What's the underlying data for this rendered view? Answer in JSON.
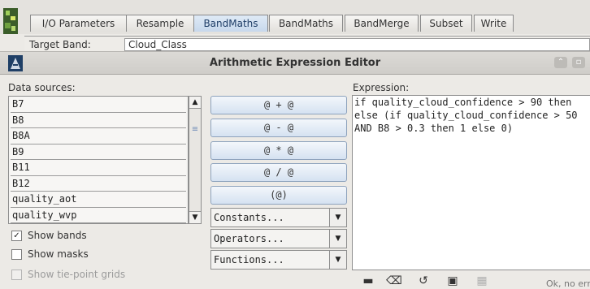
{
  "tabs": [
    {
      "label": "I/O Parameters",
      "active": false
    },
    {
      "label": "Resample",
      "active": false
    },
    {
      "label": "BandMaths",
      "active": true
    },
    {
      "label": "BandMaths",
      "active": false
    },
    {
      "label": "BandMerge",
      "active": false
    },
    {
      "label": "Subset",
      "active": false
    },
    {
      "label": "Write",
      "active": false
    }
  ],
  "target": {
    "label": "Target Band:",
    "value": "Cloud_Class"
  },
  "dialog": {
    "title": "Arithmetic Expression Editor"
  },
  "data_sources": {
    "label": "Data sources:",
    "items": [
      "B7",
      "B8",
      "B8A",
      "B9",
      "B11",
      "B12",
      "quality_aot",
      "quality_wvp"
    ]
  },
  "operators": [
    "@ + @",
    "@ - @",
    "@ * @",
    "@ / @",
    "(@)"
  ],
  "combos": [
    {
      "label": "Constants..."
    },
    {
      "label": "Operators..."
    },
    {
      "label": "Functions..."
    }
  ],
  "expression": {
    "label": "Expression:",
    "lines": [
      "if quality_cloud_confidence > 90 then",
      "else (if quality_cloud_confidence > 50",
      "AND B8 > 0.3 then 1 else 0)"
    ]
  },
  "checkboxes": [
    {
      "label": "Show bands",
      "checked": true,
      "enabled": true
    },
    {
      "label": "Show masks",
      "checked": false,
      "enabled": true
    },
    {
      "label": "Show tie-point grids",
      "checked": false,
      "enabled": false
    }
  ],
  "footer": {
    "ok_text": "Ok, no err"
  },
  "icons": [
    "app-icon",
    "dialog-icon",
    "window-up-icon",
    "window-restore-icon",
    "scroll-up-icon",
    "scroll-down-icon",
    "checkmark-icon",
    "chevron-down-icon",
    "keyboard-icon",
    "delete-icon",
    "undo-icon",
    "history-icon",
    "save-icon"
  ],
  "colors": {
    "active_tab": "#c7d8ec",
    "op_button": "#d5e2f1",
    "title_bar": "#cfcdc9"
  }
}
